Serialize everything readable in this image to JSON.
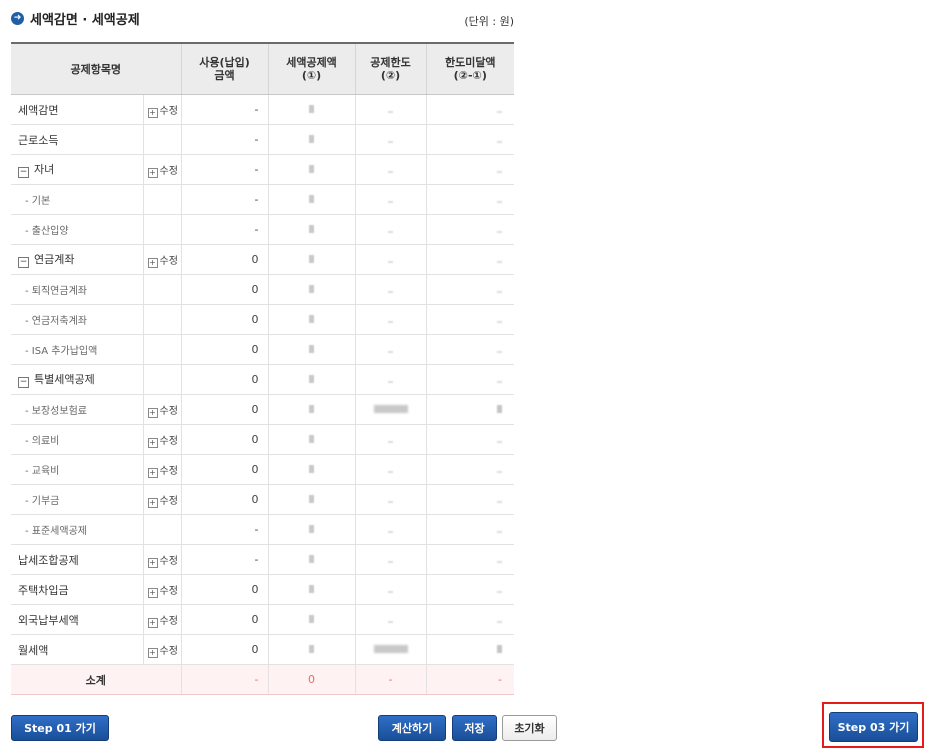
{
  "header": {
    "title_icon": "arrow-right-circle-icon",
    "title": "세액감면 · 세액공제",
    "unit": "(단위 : 원)"
  },
  "table": {
    "columns": [
      "공제항목명",
      "사용(납입) 금액",
      "세액공제액 (①)",
      "공제한도 (②)",
      "한도미달액 (②-①)"
    ],
    "rows": [
      {
        "name": "세액감면",
        "level": 0,
        "edit": "수정",
        "amount": "-",
        "credit": "",
        "limit": "",
        "shortfall": ""
      },
      {
        "name": "근로소득",
        "level": 0,
        "edit": "",
        "amount": "-",
        "credit": "",
        "limit": "",
        "shortfall": ""
      },
      {
        "name": "자녀",
        "level": 0,
        "collapsible": true,
        "edit": "수정",
        "amount": "-",
        "credit": "",
        "limit": "",
        "shortfall": ""
      },
      {
        "name": "- 기본",
        "level": 1,
        "edit": "",
        "amount": "-",
        "credit": "",
        "limit": "",
        "shortfall": ""
      },
      {
        "name": "- 출산입양",
        "level": 1,
        "edit": "",
        "amount": "-",
        "credit": "",
        "limit": "",
        "shortfall": ""
      },
      {
        "name": "연금계좌",
        "level": 0,
        "collapsible": true,
        "edit": "수정",
        "amount": "0",
        "credit": "",
        "limit": "",
        "shortfall": ""
      },
      {
        "name": "- 퇴직연금계좌",
        "level": 1,
        "edit": "",
        "amount": "0",
        "credit": "",
        "limit": "",
        "shortfall": ""
      },
      {
        "name": "- 연금저축계좌",
        "level": 1,
        "edit": "",
        "amount": "0",
        "credit": "",
        "limit": "",
        "shortfall": ""
      },
      {
        "name": "- ISA 추가납입액",
        "level": 1,
        "edit": "",
        "amount": "0",
        "credit": "",
        "limit": "",
        "shortfall": ""
      },
      {
        "name": "특별세액공제",
        "level": 0,
        "collapsible": true,
        "edit": "",
        "amount": "0",
        "credit": "",
        "limit": "",
        "shortfall": ""
      },
      {
        "name": "- 보장성보험료",
        "level": 1,
        "edit": "수정",
        "amount": "0",
        "credit": "",
        "limit": "blurred",
        "shortfall": "blurred"
      },
      {
        "name": "- 의료비",
        "level": 1,
        "edit": "수정",
        "amount": "0",
        "credit": "",
        "limit": "",
        "shortfall": ""
      },
      {
        "name": "- 교육비",
        "level": 1,
        "edit": "수정",
        "amount": "0",
        "credit": "",
        "limit": "",
        "shortfall": ""
      },
      {
        "name": "- 기부금",
        "level": 1,
        "edit": "수정",
        "amount": "0",
        "credit": "",
        "limit": "",
        "shortfall": ""
      },
      {
        "name": "- 표준세액공제",
        "level": 1,
        "edit": "",
        "amount": "-",
        "credit": "",
        "limit": "",
        "shortfall": ""
      },
      {
        "name": "납세조합공제",
        "level": 0,
        "edit": "수정",
        "amount": "-",
        "credit": "",
        "limit": "",
        "shortfall": ""
      },
      {
        "name": "주택차입금",
        "level": 0,
        "edit": "수정",
        "amount": "0",
        "credit": "",
        "limit": "",
        "shortfall": ""
      },
      {
        "name": "외국납부세액",
        "level": 0,
        "edit": "수정",
        "amount": "0",
        "credit": "",
        "limit": "",
        "shortfall": ""
      },
      {
        "name": "월세액",
        "level": 0,
        "edit": "수정",
        "amount": "0",
        "credit": "",
        "limit": "blurred",
        "shortfall": "blurred"
      }
    ],
    "total": {
      "label": "소계",
      "amount": "-",
      "credit": "0",
      "limit": "-",
      "shortfall": "-"
    }
  },
  "buttons": {
    "step01": "Step 01 가기",
    "calculate": "계산하기",
    "save": "저장",
    "reset": "초기화",
    "step03": "Step 03 가기"
  },
  "colors": {
    "accent": "#1f5fa8",
    "total_text": "#e63434",
    "highlight": "#e51b1b"
  }
}
